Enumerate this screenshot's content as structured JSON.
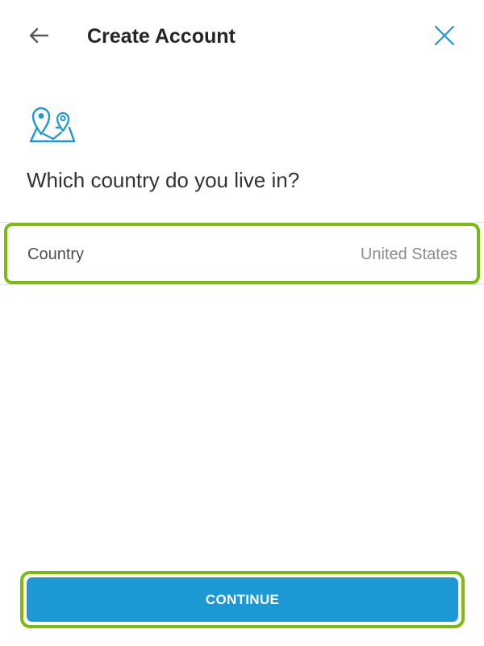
{
  "header": {
    "title": "Create Account",
    "back_icon": "arrow-left-icon",
    "close_icon": "close-icon"
  },
  "content": {
    "illustration_icon": "map-location-pins-icon",
    "question": "Which country do you live in?",
    "country_field": {
      "label": "Country",
      "value": "United States"
    }
  },
  "footer": {
    "continue_label": "CONTINUE"
  },
  "colors": {
    "accent_blue": "#1c98d5",
    "highlight_green": "#7bba11",
    "title_text": "#262626",
    "body_text": "#333333",
    "muted_text": "#8c8c8c"
  }
}
